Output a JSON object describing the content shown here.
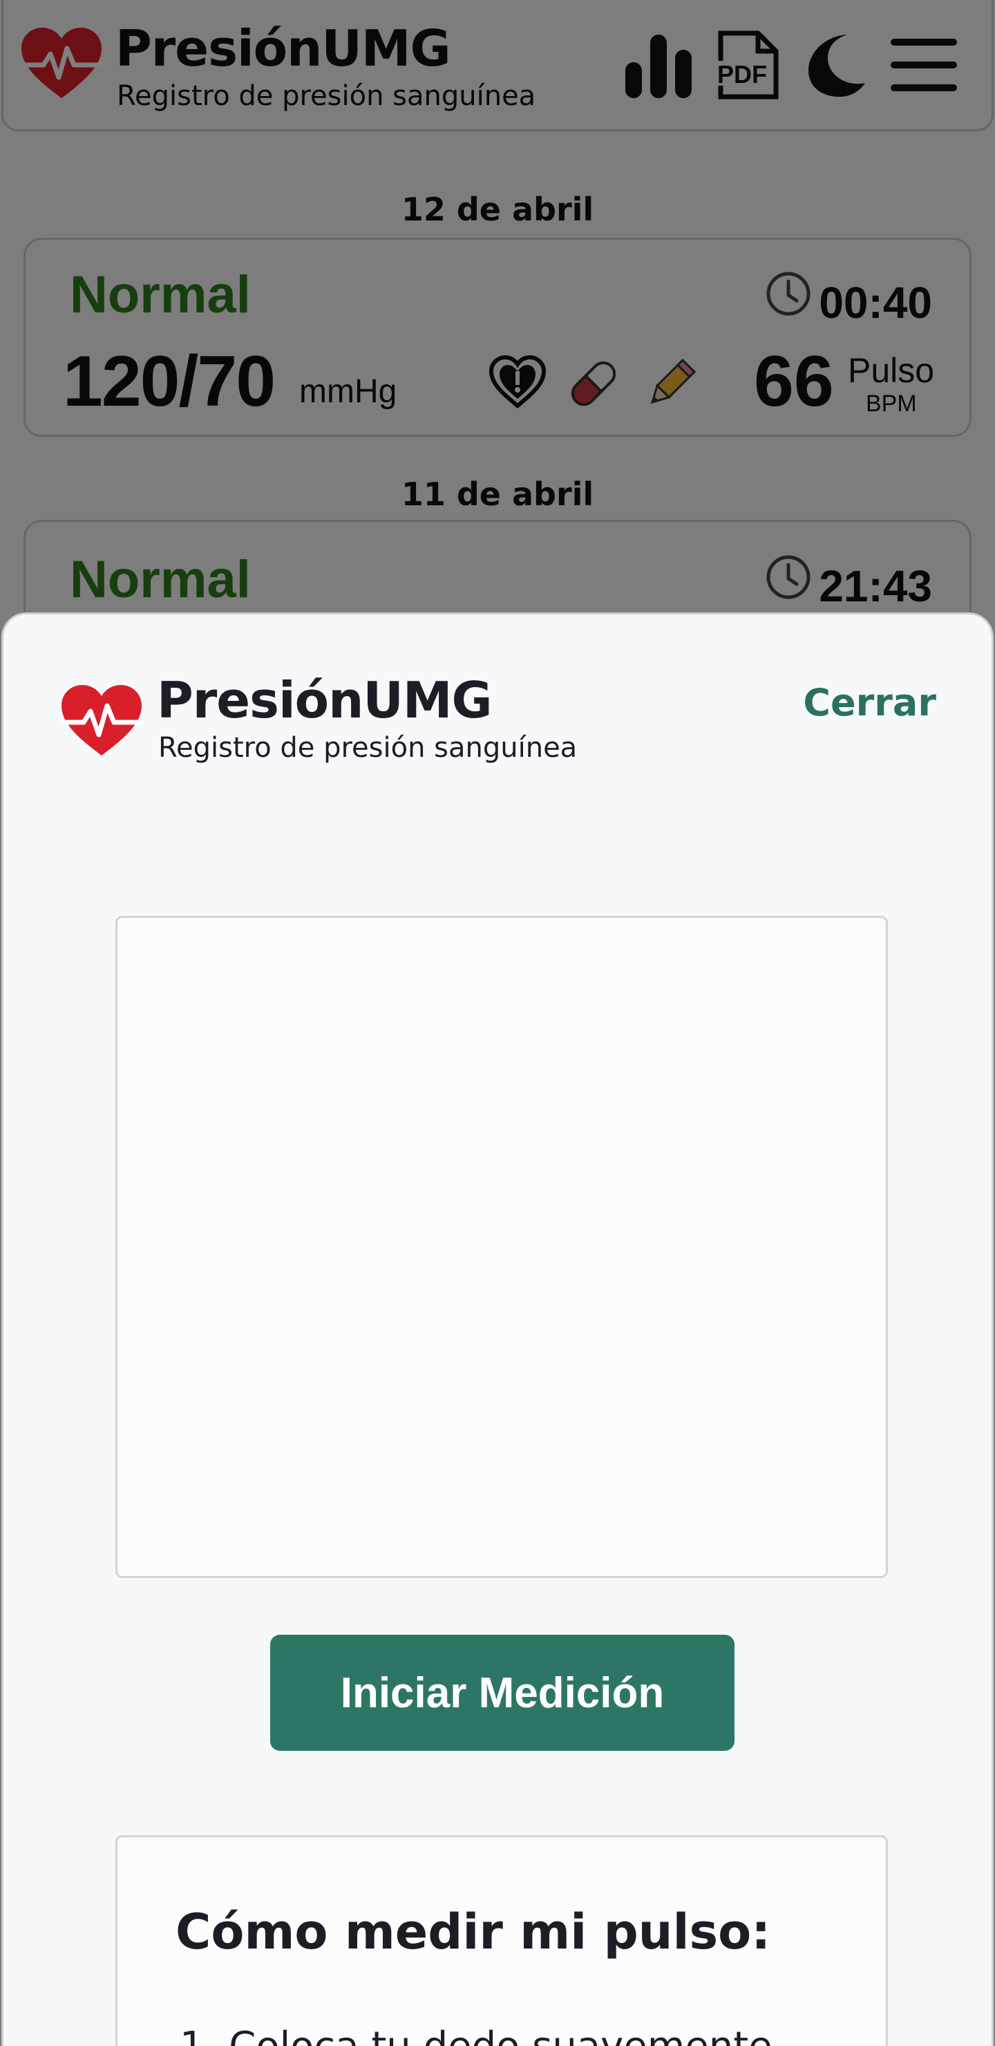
{
  "app": {
    "title": "PresiónUMG",
    "subtitle": "Registro de presión sanguínea"
  },
  "header_icons": [
    "bar-chart-icon",
    "pdf-icon",
    "moon-icon",
    "menu-icon"
  ],
  "header_pdf_label": "PDF",
  "entries": [
    {
      "date": "12 de abril",
      "status": "Normal",
      "time": "00:40",
      "bp": "120/70",
      "unit": "mmHg",
      "pulse": "66",
      "pulse_label": "Pulso",
      "pulse_unit": "BPM"
    },
    {
      "date": "11 de abril",
      "status": "Normal",
      "time": "21:43"
    }
  ],
  "sheet": {
    "title": "PresiónUMG",
    "subtitle": "Registro de presión sanguínea",
    "close_label": "Cerrar",
    "start_label": "Iniciar Medición",
    "howto_title": "Cómo medir mi pulso:",
    "howto_steps": [
      "Coloca tu dedo suavemente"
    ]
  },
  "colors": {
    "status_normal": "#2e7d1e",
    "accent": "#2d7665",
    "heart": "#d9202a"
  }
}
